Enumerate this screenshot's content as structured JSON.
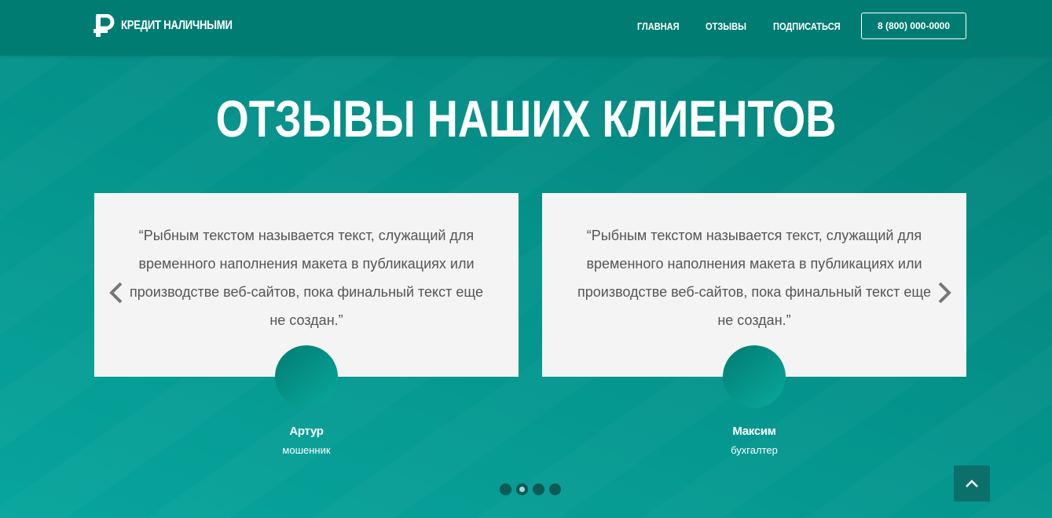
{
  "header": {
    "logo_text": "КРЕДИТ НАЛИЧНЫМИ",
    "nav": [
      {
        "label": "ГЛАВНАЯ"
      },
      {
        "label": "ОТЗЫВЫ"
      },
      {
        "label": "ПОДПИСАТЬСЯ"
      }
    ],
    "phone": "8 (800) 000-0000"
  },
  "section": {
    "title": "ОТЗЫВЫ НАШИХ КЛИЕНТОВ"
  },
  "testimonials": [
    {
      "quote": "“Рыбным текстом называется текст, служащий для временного наполнения макета в публикациях или производстве веб-сайтов, пока финальный текст еще не создан.”",
      "name": "Артур",
      "role": "мошенник"
    },
    {
      "quote": "“Рыбным текстом называется текст, служащий для временного наполнения макета в публикациях или производстве веб-сайтов, пока финальный текст еще не создан.”",
      "name": "Максим",
      "role": "бухгалтер"
    }
  ],
  "carousel": {
    "dot_count": 4,
    "active_dot": 2
  },
  "icons": {
    "logo": "ruble-icon",
    "prev": "chevron-left-icon",
    "next": "chevron-right-icon",
    "to_top": "chevron-up-icon"
  },
  "colors": {
    "header": "#017c72",
    "accent": "#04918a",
    "card": "#f4f4f4",
    "dot": "#0b5a54"
  }
}
